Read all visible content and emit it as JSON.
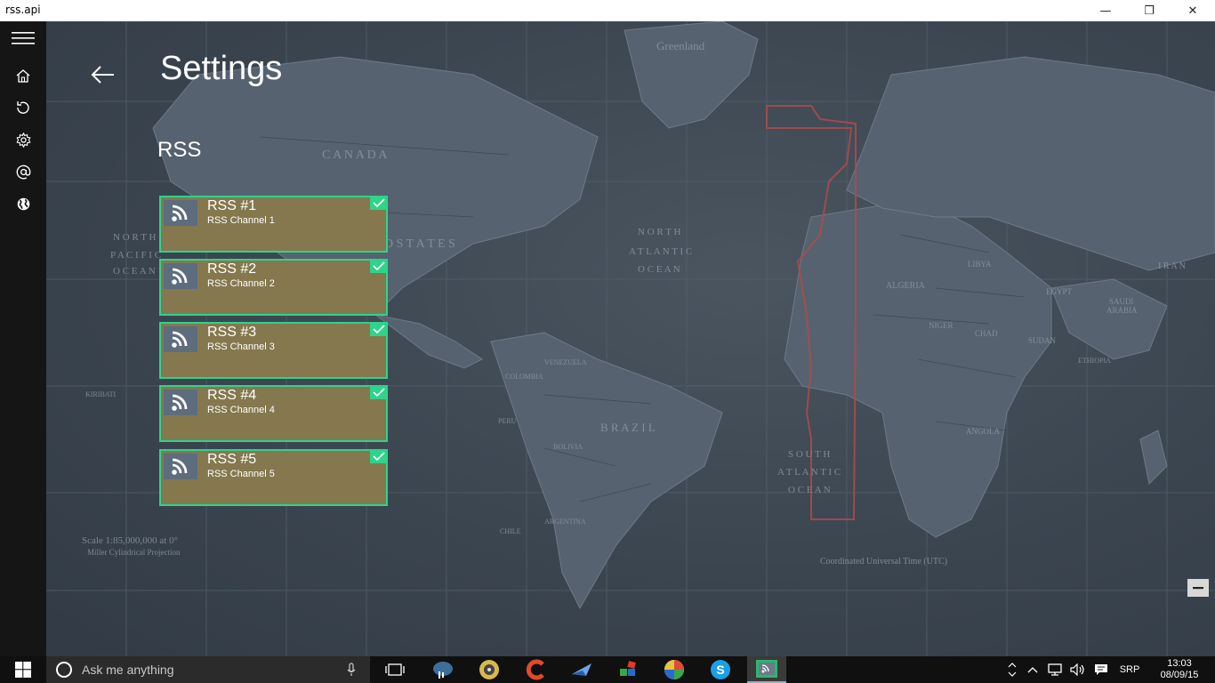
{
  "window": {
    "title": "rss.api",
    "minimize": "—",
    "maximize": "❐",
    "close": "✕"
  },
  "sidebar": {
    "items": [
      {
        "icon": "hamburger-menu-icon"
      },
      {
        "icon": "home-icon"
      },
      {
        "icon": "refresh-icon"
      },
      {
        "icon": "gear-icon"
      },
      {
        "icon": "at-sign-icon"
      },
      {
        "icon": "globe-icon"
      }
    ]
  },
  "page": {
    "title": "Settings",
    "section": "RSS"
  },
  "feeds": [
    {
      "name": "RSS #1",
      "channel": "RSS Channel 1",
      "enabled": true
    },
    {
      "name": "RSS #2",
      "channel": "RSS Channel 2",
      "enabled": true
    },
    {
      "name": "RSS #3",
      "channel": "RSS Channel 3",
      "enabled": true
    },
    {
      "name": "RSS #4",
      "channel": "RSS Channel 4",
      "enabled": true
    },
    {
      "name": "RSS #5",
      "channel": "RSS Channel 5",
      "enabled": true
    }
  ],
  "map_labels": {
    "greenland": "Greenland",
    "canada": "C A N A D A",
    "united_states": "D   S T A T E S",
    "north_atlantic_1": "N O R T H",
    "north_atlantic_2": "A T L A N T I C",
    "north_atlantic_3": "O C E A N",
    "south_atlantic_1": "S O U T H",
    "south_atlantic_2": "A T L A N T I C",
    "south_atlantic_3": "O C E A N",
    "brazil": "B R A Z I L",
    "algeria": "ALGERIA",
    "libya": "LIBYA",
    "egypt": "EGYPT",
    "saudi": "SAUDI",
    "arabia": "ARABIA",
    "iran": "I R A N",
    "niger": "NIGER",
    "chad": "CHAD",
    "sudan": "SUDAN",
    "ethiopia": "ETHIOPIA",
    "angola": "ANGOLA",
    "colombia": "COLOMBIA",
    "venezuela": "VENEZUELA",
    "peru": "PERU",
    "bolivia": "BOLIVIA",
    "argentina": "ARGENTINA",
    "chile": "CHILE",
    "north_pacific_1": "N O R T H",
    "north_pacific_2": "P A C I F I C",
    "north_pacific_3": "O C E A N",
    "kiribati": "KIRIBATI",
    "scale": "Scale 1:85,000,000 at 0°",
    "projection": "Miller Cylindrical Projection",
    "utc": "Coordinated Universal Time (UTC)"
  },
  "taskbar": {
    "search_placeholder": "Ask me anything",
    "apps": [
      "task-view-icon",
      "elephant-app-icon",
      "dvd-app-icon",
      "ccleaner-app-icon",
      "plane-app-icon",
      "blocks-app-icon",
      "picasa-app-icon",
      "skype-app-icon",
      "rss-app-icon"
    ],
    "language": "SRP",
    "time": "13:03",
    "date": "08/09/15"
  }
}
